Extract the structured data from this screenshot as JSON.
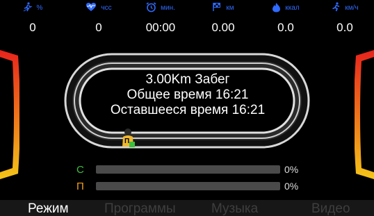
{
  "stats": [
    {
      "icon": "incline-icon",
      "unit": "%",
      "value": "0"
    },
    {
      "icon": "heart-rate-icon",
      "unit": "чсс",
      "value": "0"
    },
    {
      "icon": "alarm-clock-icon",
      "unit": "мин.",
      "value": "00:00"
    },
    {
      "icon": "finish-flag-icon",
      "unit": "км",
      "value": "0.00"
    },
    {
      "icon": "flame-icon",
      "unit": "ккал",
      "value": "0.0"
    },
    {
      "icon": "runner-icon",
      "unit": "км/ч",
      "value": "0.0"
    }
  ],
  "info": {
    "line1": "3.00Km Забег",
    "line2": "Общее время 16:21",
    "line3": "Оставшееся время 16:21"
  },
  "runner_badge": "П",
  "progress": [
    {
      "letter": "С",
      "percent_text": "0%",
      "level": 0,
      "letter_color": "#3dbf3d"
    },
    {
      "letter": "П",
      "percent_text": "0%",
      "level": 0,
      "letter_color": "#f0a020"
    }
  ],
  "tabs": [
    {
      "label": "Режим",
      "active": true
    },
    {
      "label": "Программы",
      "active": false
    },
    {
      "label": "Музыка",
      "active": false
    },
    {
      "label": "Видео",
      "active": false
    }
  ],
  "colors": {
    "accent_blue": "#2f6bff",
    "side_red": "#e8241c",
    "side_yellow": "#f5c518"
  }
}
